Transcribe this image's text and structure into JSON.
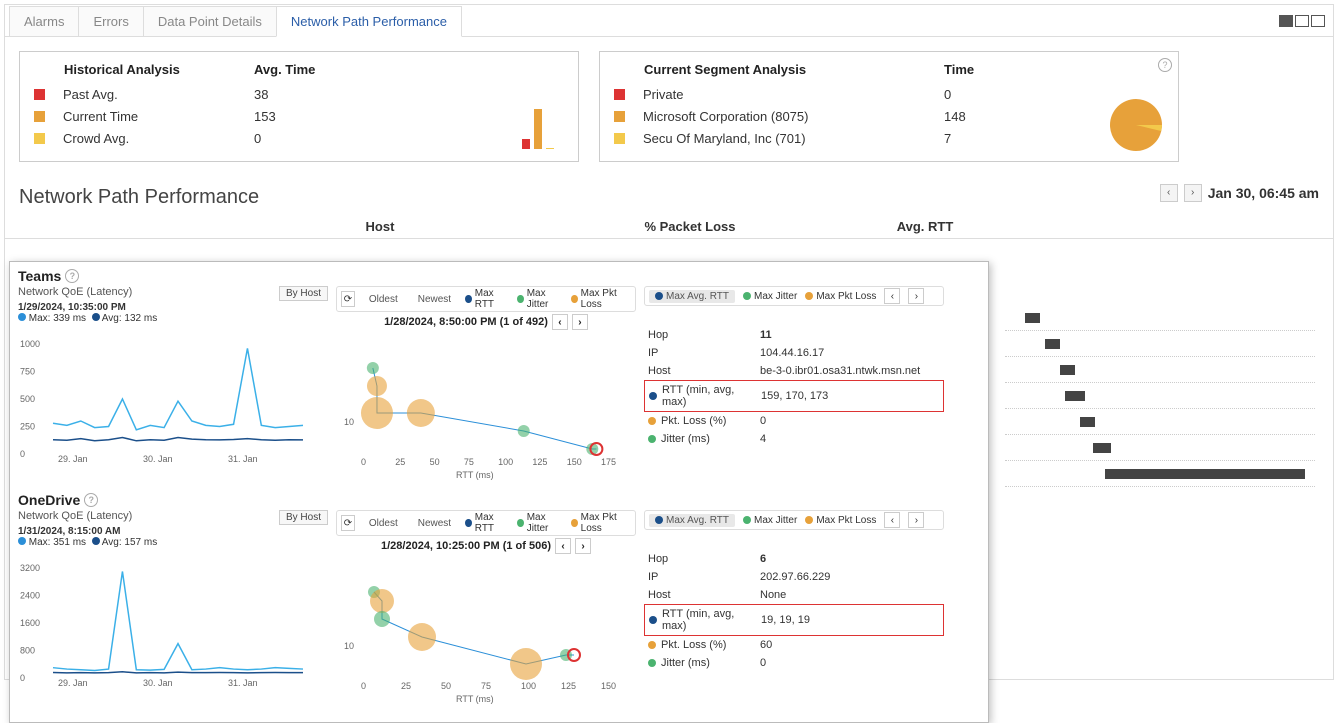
{
  "tabs": {
    "alarms": "Alarms",
    "errors": "Errors",
    "dpd": "Data Point Details",
    "npp": "Network Path Performance"
  },
  "hist": {
    "title": "Historical Analysis",
    "col2": "Avg. Time",
    "rows": [
      {
        "color": "#d33",
        "label": "Past Avg.",
        "val": "38"
      },
      {
        "color": "#e7a13a",
        "label": "Current Time",
        "val": "153"
      },
      {
        "color": "#f3c94b",
        "label": "Crowd Avg.",
        "val": "0"
      }
    ]
  },
  "seg": {
    "title": "Current Segment Analysis",
    "col2": "Time",
    "rows": [
      {
        "color": "#d33",
        "label": "Private",
        "val": "0"
      },
      {
        "color": "#e7a13a",
        "label": "Microsoft Corporation (8075)",
        "val": "148"
      },
      {
        "color": "#f3c94b",
        "label": "Secu Of Maryland, Inc (701)",
        "val": "7"
      }
    ]
  },
  "section": "Network Path Performance",
  "timestamp": "Jan 30, 06:45 am",
  "cols": {
    "host": "Host",
    "pkt": "% Packet Loss",
    "rtt": "Avg. RTT"
  },
  "legendLabels": {
    "oldest": "Oldest",
    "newest": "Newest",
    "maxrtt": "Max RTT",
    "maxjitter": "Max Jitter",
    "maxpkt": "Max Pkt Loss",
    "maxavgrtt": "Max Avg. RTT",
    "byhost": "By Host"
  },
  "groups": [
    {
      "name": "Teams",
      "sub": "Network QoE (Latency)",
      "chartTs": "1/29/2024, 10:35:00 PM",
      "chartMax": "Max: 339 ms",
      "chartAvg": "Avg: 132 ms",
      "scatterHdr": "1/28/2024, 8:50:00 PM  (1 of 492)",
      "detail": {
        "hop": "11",
        "ip": "104.44.16.17",
        "host": "be-3-0.ibr01.osa31.ntwk.msn.net",
        "rtt": "159, 170, 173",
        "pkt": "0",
        "jitter": "4"
      }
    },
    {
      "name": "OneDrive",
      "sub": "Network QoE (Latency)",
      "chartTs": "1/31/2024, 8:15:00 AM",
      "chartMax": "Max: 351 ms",
      "chartAvg": "Avg: 157 ms",
      "scatterHdr": "1/28/2024, 10:25:00 PM  (1 of 506)",
      "detail": {
        "hop": "6",
        "ip": "202.97.66.229",
        "host": "None",
        "rtt": "19, 19, 19",
        "pkt": "60",
        "jitter": "0"
      }
    }
  ],
  "detailLabels": {
    "hop": "Hop",
    "ip": "IP",
    "host": "Host",
    "rtt": "RTT (min, avg, max)",
    "pkt": "Pkt. Loss (%)",
    "jitter": "Jitter (ms)"
  },
  "chart_data": [
    {
      "type": "bar",
      "title": "Historical Analysis Avg. Time",
      "categories": [
        "Past Avg.",
        "Current Time",
        "Crowd Avg."
      ],
      "values": [
        38,
        153,
        0
      ],
      "colors": [
        "#d33",
        "#e7a13a",
        "#f3c94b"
      ]
    },
    {
      "type": "pie",
      "title": "Current Segment Analysis Time",
      "categories": [
        "Private",
        "Microsoft Corporation (8075)",
        "Secu Of Maryland, Inc (701)"
      ],
      "values": [
        0,
        148,
        7
      ],
      "colors": [
        "#d33",
        "#e7a13a",
        "#f3c94b"
      ]
    },
    {
      "type": "line",
      "title": "Teams Network QoE (Latency)",
      "xlabel": "",
      "ylabel": "ms",
      "ylim": [
        0,
        1000
      ],
      "yticks": [
        0,
        250,
        500,
        750,
        1000
      ],
      "xticks": [
        "29. Jan",
        "30. Jan",
        "31. Jan"
      ],
      "series": [
        {
          "name": "Max",
          "color": "#3bb0e8",
          "approx": true,
          "values": [
            280,
            260,
            300,
            240,
            250,
            500,
            220,
            260,
            240,
            480,
            300,
            260,
            250,
            270,
            960,
            260,
            240,
            250,
            260
          ]
        },
        {
          "name": "Avg",
          "color": "#1b4f8a",
          "approx": true,
          "values": [
            130,
            125,
            140,
            120,
            130,
            150,
            120,
            130,
            125,
            150,
            135,
            130,
            128,
            132,
            140,
            130,
            125,
            130,
            128
          ]
        }
      ]
    },
    {
      "type": "scatter",
      "title": "Teams RTT scatter",
      "xlabel": "RTT (ms)",
      "xlim": [
        0,
        175
      ],
      "xticks": [
        0,
        25,
        50,
        75,
        100,
        125,
        150,
        175
      ],
      "ylabel": "hop",
      "yticks": [
        10
      ],
      "points": [
        {
          "x": 5,
          "y": 2,
          "r": 6,
          "c": "#4bb36f"
        },
        {
          "x": 8,
          "y": 4,
          "r": 10,
          "c": "#e7a13a"
        },
        {
          "x": 8,
          "y": 7,
          "r": 16,
          "c": "#e7a13a"
        },
        {
          "x": 40,
          "y": 7,
          "r": 14,
          "c": "#e7a13a"
        },
        {
          "x": 115,
          "y": 9,
          "r": 6,
          "c": "#4bb36f"
        },
        {
          "x": 165,
          "y": 11,
          "r": 6,
          "c": "#4bb36f"
        },
        {
          "x": 168,
          "y": 11,
          "r": 6,
          "c": "#d33",
          "ring": true
        }
      ]
    },
    {
      "type": "line",
      "title": "OneDrive Network QoE (Latency)",
      "xlabel": "",
      "ylabel": "ms",
      "ylim": [
        0,
        3200
      ],
      "yticks": [
        0,
        800,
        1600,
        2400,
        3200
      ],
      "xticks": [
        "29. Jan",
        "30. Jan",
        "31. Jan"
      ],
      "series": [
        {
          "name": "Max",
          "color": "#3bb0e8",
          "approx": true,
          "values": [
            300,
            260,
            240,
            220,
            260,
            3100,
            240,
            230,
            250,
            1000,
            240,
            260,
            300,
            260,
            240,
            260,
            300,
            280,
            260
          ]
        },
        {
          "name": "Avg",
          "color": "#1b4f8a",
          "approx": true,
          "values": [
            160,
            150,
            155,
            150,
            158,
            180,
            150,
            155,
            150,
            170,
            155,
            158,
            160,
            155,
            150,
            155,
            160,
            158,
            155
          ]
        }
      ]
    },
    {
      "type": "scatter",
      "title": "OneDrive RTT scatter",
      "xlabel": "RTT (ms)",
      "xlim": [
        0,
        150
      ],
      "xticks": [
        0,
        25,
        50,
        75,
        100,
        125,
        150
      ],
      "ylabel": "hop",
      "yticks": [
        10
      ],
      "points": [
        {
          "x": 5,
          "y": 2,
          "r": 6,
          "c": "#4bb36f"
        },
        {
          "x": 10,
          "y": 3,
          "r": 12,
          "c": "#e7a13a"
        },
        {
          "x": 10,
          "y": 5,
          "r": 8,
          "c": "#4bb36f"
        },
        {
          "x": 35,
          "y": 7,
          "r": 14,
          "c": "#e7a13a"
        },
        {
          "x": 100,
          "y": 10,
          "r": 16,
          "c": "#e7a13a"
        },
        {
          "x": 125,
          "y": 9,
          "r": 6,
          "c": "#4bb36f"
        },
        {
          "x": 130,
          "y": 9,
          "r": 6,
          "c": "#d33",
          "ring": true
        }
      ]
    },
    {
      "type": "bar",
      "title": "Avg. RTT gantt",
      "orientation": "h",
      "categories": [
        "r1",
        "r2",
        "r3",
        "r4",
        "r5",
        "r6",
        "r7"
      ],
      "bars": [
        {
          "start": 20,
          "len": 15
        },
        {
          "start": 40,
          "len": 15
        },
        {
          "start": 55,
          "len": 15
        },
        {
          "start": 60,
          "len": 20
        },
        {
          "start": 75,
          "len": 15
        },
        {
          "start": 88,
          "len": 18
        },
        {
          "start": 100,
          "len": 200
        }
      ]
    }
  ]
}
